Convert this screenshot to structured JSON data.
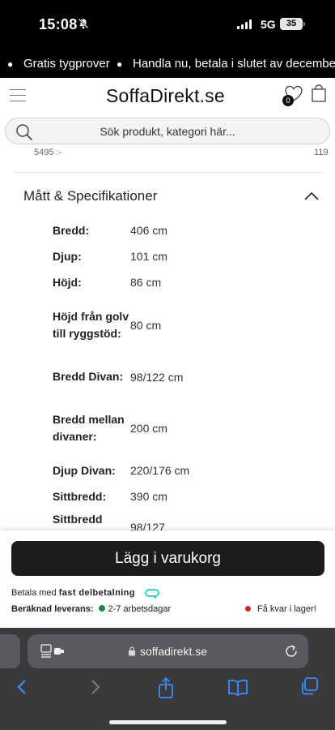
{
  "status_bar": {
    "time": "15:08",
    "network": "5G",
    "battery": "35"
  },
  "ticker": {
    "item1": "Gratis tygprover",
    "item2": "Handla nu, betala i slutet av december"
  },
  "header": {
    "logo_part1": "Soffa",
    "logo_part2": "Direkt.se",
    "wishlist_count": "0"
  },
  "search": {
    "placeholder": "Sök produkt, kategori här..."
  },
  "prev_prices": {
    "left": "5495 :-",
    "right": "119"
  },
  "specs_section": {
    "title": "Mått & Specifikationer",
    "rows": [
      {
        "label": "Bredd:",
        "value": "406 cm"
      },
      {
        "label": "Djup:",
        "value": "101 cm"
      },
      {
        "label": "Höjd:",
        "value": "86 cm"
      },
      {
        "label": "Höjd från golv till ryggstöd:",
        "value": "80 cm"
      },
      {
        "label": "Bredd Divan:",
        "value": "98/122 cm"
      },
      {
        "label": "Bredd mellan divaner:",
        "value": "200 cm"
      },
      {
        "label": "Djup Divan:",
        "value": "220/176 cm"
      },
      {
        "label": "Sittbredd:",
        "value": "390 cm"
      },
      {
        "label": "Sittbredd",
        "value": "98/127"
      }
    ]
  },
  "cart": {
    "button_label": "Lägg i varukorg",
    "pay_prefix": "Betala med",
    "pay_strong": "fast delbetalning",
    "delivery_label": "Beräknad leverans:",
    "delivery_value": "2-7 arbetsdagar",
    "stock_text": "Få kvar i lager!"
  },
  "safari": {
    "url": "soffadirekt.se"
  }
}
